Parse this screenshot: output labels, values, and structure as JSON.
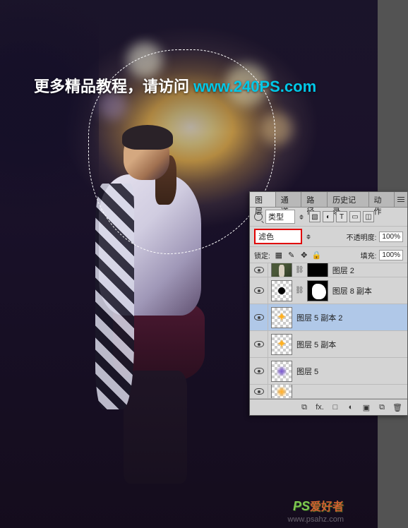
{
  "promo": {
    "text_cn": "更多精品教程，请访问 ",
    "link_text": "www.240PS.com"
  },
  "watermark": {
    "logo_prefix": "PS",
    "logo_cn": "爱好者",
    "url": "www.psahz.com"
  },
  "panel": {
    "tabs": {
      "layers": "图层",
      "channels": "通道",
      "paths": "路径",
      "history": "历史记录",
      "actions": "动作"
    },
    "type_row": {
      "type_label": "类型"
    },
    "blend_row": {
      "mode": "滤色",
      "opacity_label": "不透明度:",
      "opacity_value": "100%"
    },
    "lock_row": {
      "lock_label": "锁定:",
      "fill_label": "填充:",
      "fill_value": "100%"
    },
    "layers": [
      {
        "name": "图层 2"
      },
      {
        "name": "图层 8 副本"
      },
      {
        "name": "图层 5 副本 2"
      },
      {
        "name": "图层 5 副本"
      },
      {
        "name": "图层 5"
      }
    ],
    "footer_icons": {
      "link": "⧉",
      "fx": "fx.",
      "mask": "□",
      "adjust": "◐",
      "group": "▣",
      "new": "⧉",
      "trash": "🗑"
    }
  }
}
